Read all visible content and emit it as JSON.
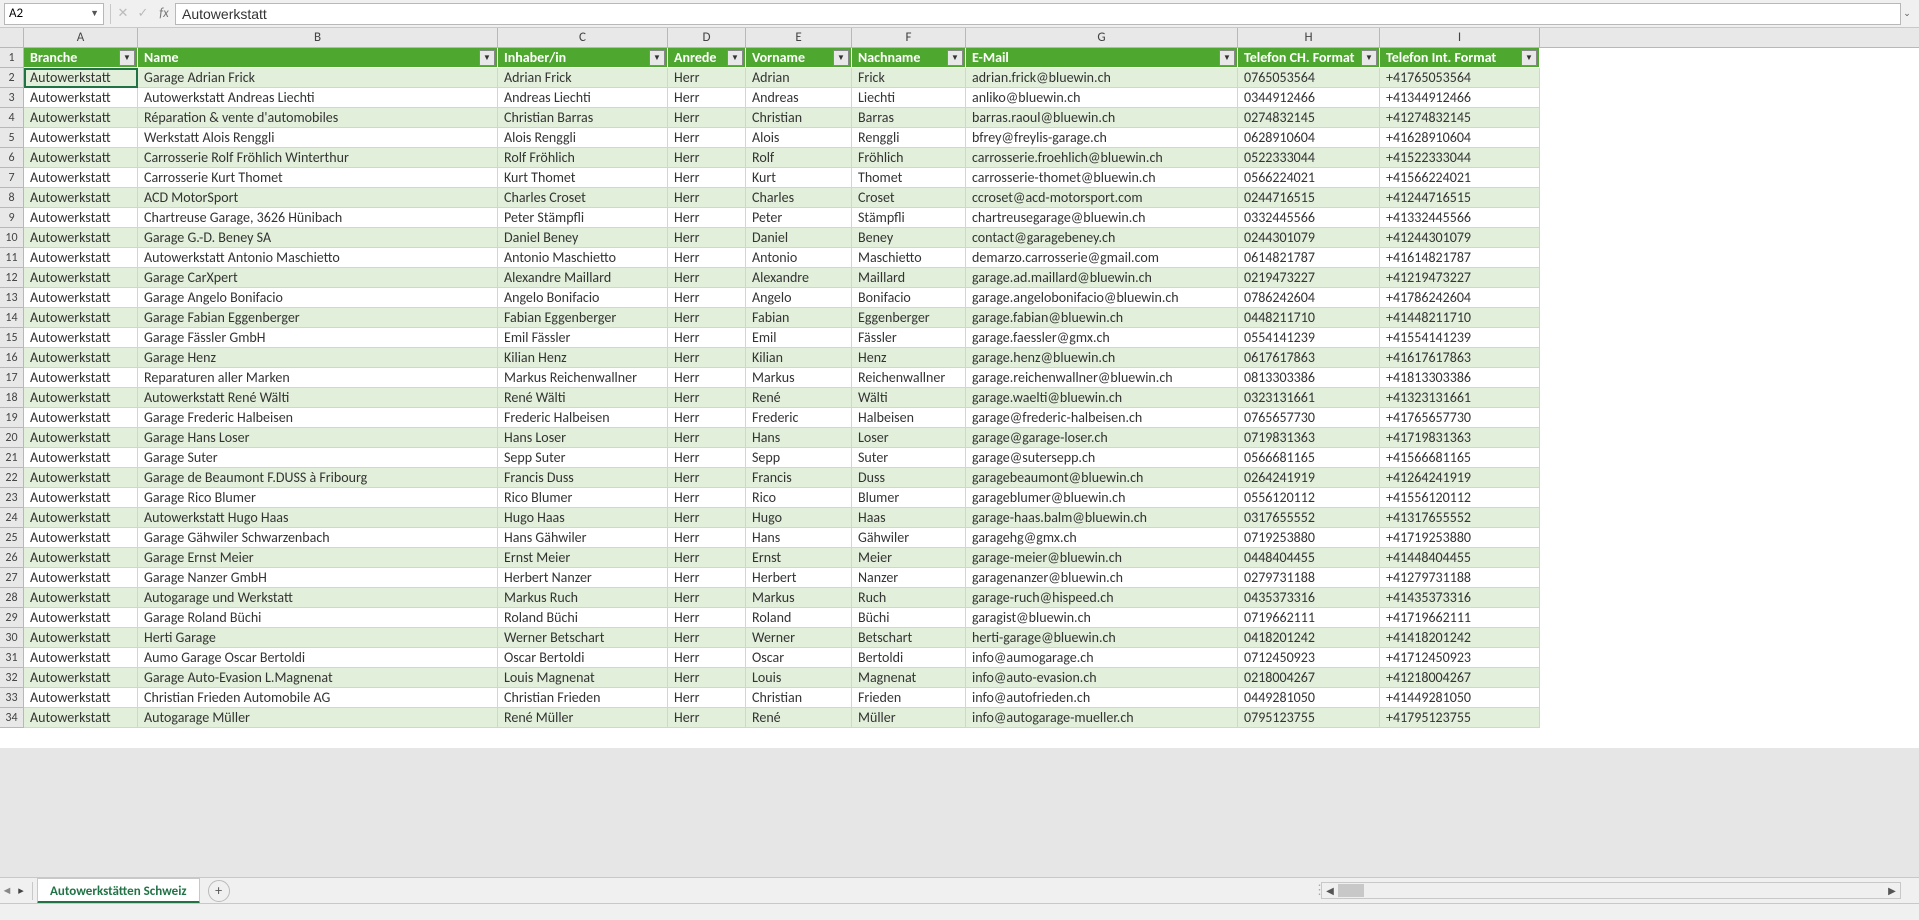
{
  "name_box": "A2",
  "formula_value": "Autowerkstatt",
  "sheet_tab": "Autowerkstätten Schweiz",
  "col_letters": [
    "A",
    "B",
    "C",
    "D",
    "E",
    "F",
    "G",
    "H",
    "I"
  ],
  "headers": [
    "Branche",
    "Name",
    "Inhaber/in",
    "Anrede",
    "Vorname",
    "Nachname",
    "E-Mail",
    "Telefon CH. Format",
    "Telefon Int. Format"
  ],
  "chart_data": {
    "type": "table",
    "columns": [
      "Branche",
      "Name",
      "Inhaber/in",
      "Anrede",
      "Vorname",
      "Nachname",
      "E-Mail",
      "Telefon CH. Format",
      "Telefon Int. Format"
    ],
    "rows": [
      [
        "Autowerkstatt",
        "Garage Adrian Frick",
        "Adrian Frick",
        "Herr",
        "Adrian",
        "Frick",
        "adrian.frick@bluewin.ch",
        "0765053564",
        "+41765053564"
      ],
      [
        "Autowerkstatt",
        "Autowerkstatt Andreas Liechti",
        "Andreas Liechti",
        "Herr",
        "Andreas",
        "Liechti",
        "anliko@bluewin.ch",
        "0344912466",
        "+41344912466"
      ],
      [
        "Autowerkstatt",
        "Réparation & vente d'automobiles",
        "Christian Barras",
        "Herr",
        "Christian",
        "Barras",
        "barras.raoul@bluewin.ch",
        "0274832145",
        "+41274832145"
      ],
      [
        "Autowerkstatt",
        "Werkstatt Alois Renggli",
        "Alois Renggli",
        "Herr",
        "Alois",
        "Renggli",
        "bfrey@freylis-garage.ch",
        "0628910604",
        "+41628910604"
      ],
      [
        "Autowerkstatt",
        "Carrosserie Rolf Fröhlich Winterthur",
        "Rolf Fröhlich",
        "Herr",
        "Rolf",
        "Fröhlich",
        "carrosserie.froehlich@bluewin.ch",
        "0522333044",
        "+41522333044"
      ],
      [
        "Autowerkstatt",
        "Carrosserie Kurt Thomet",
        "Kurt Thomet",
        "Herr",
        "Kurt",
        "Thomet",
        "carrosserie-thomet@bluewin.ch",
        "0566224021",
        "+41566224021"
      ],
      [
        "Autowerkstatt",
        "ACD MotorSport",
        "Charles Croset",
        "Herr",
        "Charles",
        "Croset",
        "ccroset@acd-motorsport.com",
        "0244716515",
        "+41244716515"
      ],
      [
        "Autowerkstatt",
        "Chartreuse Garage, 3626 Hünibach",
        "Peter Stämpfli",
        "Herr",
        "Peter",
        "Stämpfli",
        "chartreusegarage@bluewin.ch",
        "0332445566",
        "+41332445566"
      ],
      [
        "Autowerkstatt",
        "Garage G.-D. Beney SA",
        "Daniel Beney",
        "Herr",
        "Daniel",
        "Beney",
        "contact@garagebeney.ch",
        "0244301079",
        "+41244301079"
      ],
      [
        "Autowerkstatt",
        "Autowerkstatt Antonio Maschietto",
        "Antonio Maschietto",
        "Herr",
        "Antonio",
        "Maschietto",
        "demarzo.carrosserie@gmail.com",
        "0614821787",
        "+41614821787"
      ],
      [
        "Autowerkstatt",
        "Garage CarXpert",
        "Alexandre Maillard",
        "Herr",
        "Alexandre",
        "Maillard",
        "garage.ad.maillard@bluewin.ch",
        "0219473227",
        "+41219473227"
      ],
      [
        "Autowerkstatt",
        "Garage Angelo Bonifacio",
        "Angelo Bonifacio",
        "Herr",
        "Angelo",
        "Bonifacio",
        "garage.angelobonifacio@bluewin.ch",
        "0786242604",
        "+41786242604"
      ],
      [
        "Autowerkstatt",
        "Garage Fabian Eggenberger",
        "Fabian Eggenberger",
        "Herr",
        "Fabian",
        "Eggenberger",
        "garage.fabian@bluewin.ch",
        "0448211710",
        "+41448211710"
      ],
      [
        "Autowerkstatt",
        "Garage Fässler GmbH",
        "Emil Fässler",
        "Herr",
        "Emil",
        "Fässler",
        "garage.faessler@gmx.ch",
        "0554141239",
        "+41554141239"
      ],
      [
        "Autowerkstatt",
        "Garage Henz",
        "Kilian Henz",
        "Herr",
        "Kilian",
        "Henz",
        "garage.henz@bluewin.ch",
        "0617617863",
        "+41617617863"
      ],
      [
        "Autowerkstatt",
        "Reparaturen aller Marken",
        "Markus Reichenwallner",
        "Herr",
        "Markus",
        "Reichenwallner",
        "garage.reichenwallner@bluewin.ch",
        "0813303386",
        "+41813303386"
      ],
      [
        "Autowerkstatt",
        "Autowerkstatt René Wälti",
        "René Wälti",
        "Herr",
        "René",
        "Wälti",
        "garage.waelti@bluewin.ch",
        "0323131661",
        "+41323131661"
      ],
      [
        "Autowerkstatt",
        "Garage Frederic Halbeisen",
        "Frederic Halbeisen",
        "Herr",
        "Frederic",
        "Halbeisen",
        "garage@frederic-halbeisen.ch",
        "0765657730",
        "+41765657730"
      ],
      [
        "Autowerkstatt",
        "Garage Hans Loser",
        "Hans Loser",
        "Herr",
        "Hans",
        "Loser",
        "garage@garage-loser.ch",
        "0719831363",
        "+41719831363"
      ],
      [
        "Autowerkstatt",
        "Garage Suter",
        "Sepp Suter",
        "Herr",
        "Sepp",
        "Suter",
        "garage@sutersepp.ch",
        "0566681165",
        "+41566681165"
      ],
      [
        "Autowerkstatt",
        "Garage de Beaumont F.DUSS à Fribourg",
        "Francis Duss",
        "Herr",
        "Francis",
        "Duss",
        "garagebeaumont@bluewin.ch",
        "0264241919",
        "+41264241919"
      ],
      [
        "Autowerkstatt",
        "Garage Rico Blumer",
        "Rico Blumer",
        "Herr",
        "Rico",
        "Blumer",
        "garageblumer@bluewin.ch",
        "0556120112",
        "+41556120112"
      ],
      [
        "Autowerkstatt",
        "Autowerkstatt Hugo Haas",
        "Hugo Haas",
        "Herr",
        "Hugo",
        "Haas",
        "garage-haas.balm@bluewin.ch",
        "0317655552",
        "+41317655552"
      ],
      [
        "Autowerkstatt",
        "Garage Gähwiler Schwarzenbach",
        "Hans Gähwiler",
        "Herr",
        "Hans",
        "Gähwiler",
        "garagehg@gmx.ch",
        "0719253880",
        "+41719253880"
      ],
      [
        "Autowerkstatt",
        "Garage Ernst Meier",
        "Ernst Meier",
        "Herr",
        "Ernst",
        "Meier",
        "garage-meier@bluewin.ch",
        "0448404455",
        "+41448404455"
      ],
      [
        "Autowerkstatt",
        "Garage Nanzer GmbH",
        "Herbert Nanzer",
        "Herr",
        "Herbert",
        "Nanzer",
        "garagenanzer@bluewin.ch",
        "0279731188",
        "+41279731188"
      ],
      [
        "Autowerkstatt",
        "Autogarage und Werkstatt",
        "Markus Ruch",
        "Herr",
        "Markus",
        "Ruch",
        "garage-ruch@hispeed.ch",
        "0435373316",
        "+41435373316"
      ],
      [
        "Autowerkstatt",
        "Garage Roland Büchi",
        "Roland Büchi",
        "Herr",
        "Roland",
        "Büchi",
        "garagist@bluewin.ch",
        "0719662111",
        "+41719662111"
      ],
      [
        "Autowerkstatt",
        "Herti Garage",
        "Werner Betschart",
        "Herr",
        "Werner",
        "Betschart",
        "herti-garage@bluewin.ch",
        "0418201242",
        "+41418201242"
      ],
      [
        "Autowerkstatt",
        "Aumo Garage Oscar Bertoldi",
        "Oscar Bertoldi",
        "Herr",
        "Oscar",
        "Bertoldi",
        "info@aumogarage.ch",
        "0712450923",
        "+41712450923"
      ],
      [
        "Autowerkstatt",
        "Garage Auto-Evasion L.Magnenat",
        "Louis Magnenat",
        "Herr",
        "Louis",
        "Magnenat",
        "info@auto-evasion.ch",
        "0218004267",
        "+41218004267"
      ],
      [
        "Autowerkstatt",
        "Christian Frieden Automobile AG",
        "Christian Frieden",
        "Herr",
        "Christian",
        "Frieden",
        "info@autofrieden.ch",
        "0449281050",
        "+41449281050"
      ],
      [
        "Autowerkstatt",
        "Autogarage Müller",
        "René Müller",
        "Herr",
        "René",
        "Müller",
        "info@autogarage-mueller.ch",
        "0795123755",
        "+41795123755"
      ]
    ]
  }
}
